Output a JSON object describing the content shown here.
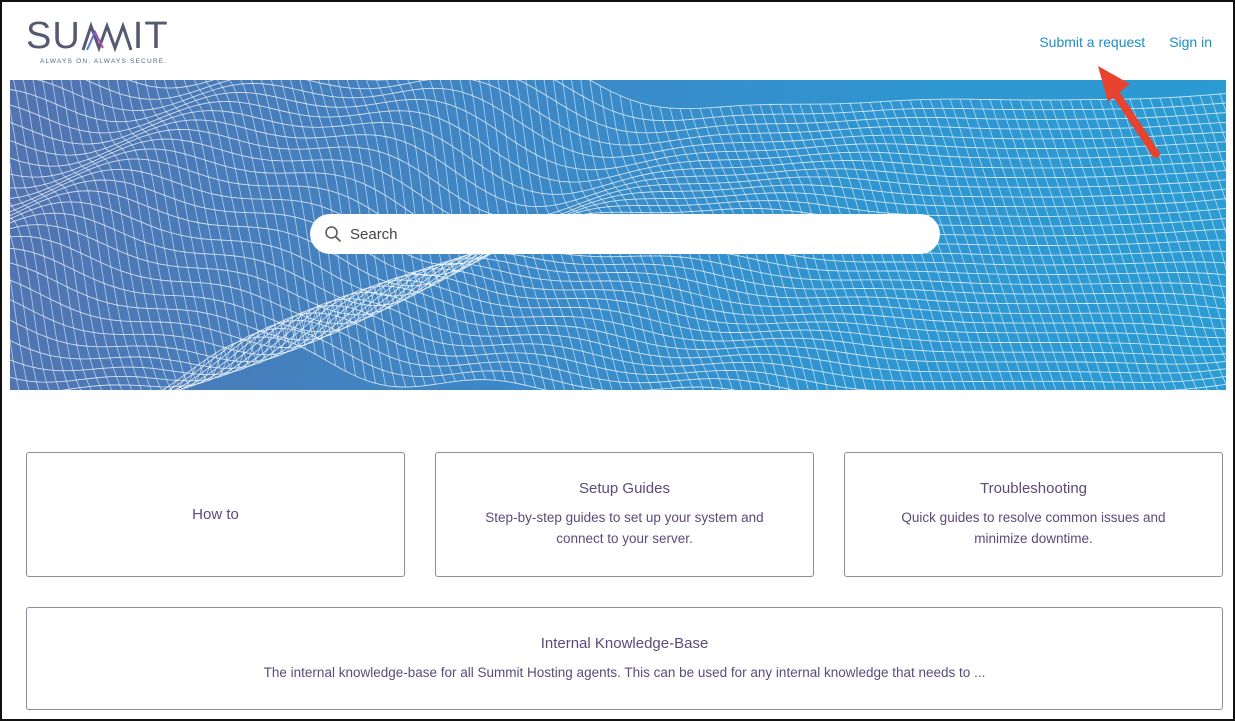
{
  "brand": {
    "name_part1": "SU",
    "name_part2": "IT",
    "tagline": "ALWAYS ON. ALWAYS SECURE.",
    "mark_icon": "mm-logo-mark"
  },
  "nav": {
    "submit_request": "Submit a request",
    "sign_in": "Sign in"
  },
  "search": {
    "placeholder": "Search"
  },
  "categories": [
    {
      "title": "How to",
      "description": ""
    },
    {
      "title": "Setup Guides",
      "description": "Step-by-step guides to set up your system and connect to your server."
    },
    {
      "title": "Troubleshooting",
      "description": "Quick guides to resolve common issues and minimize downtime."
    },
    {
      "title": "Internal Knowledge-Base",
      "description": "The internal knowledge-base for all Summit Hosting agents. This can be used for any internal knowledge that needs to ..."
    }
  ],
  "colors": {
    "link": "#1a8fc6",
    "card_text": "#5b4a7a",
    "card_border": "#8f8aa6",
    "hero_start": "#5273b0",
    "hero_end": "#2b9cd3",
    "annotation_arrow": "#e8432f"
  }
}
